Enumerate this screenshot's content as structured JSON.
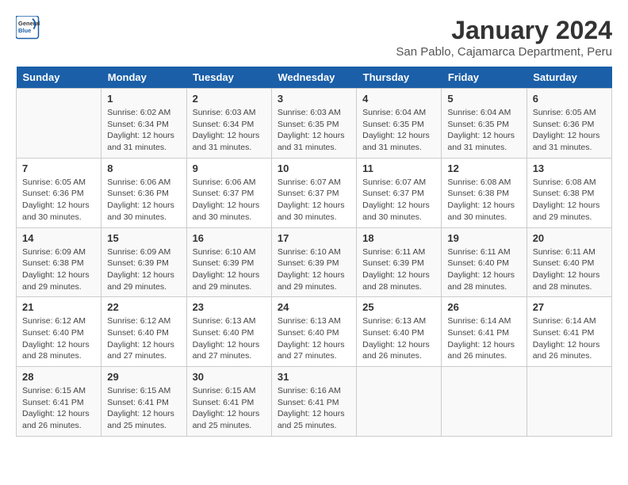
{
  "header": {
    "logo_line1": "General",
    "logo_line2": "Blue",
    "title": "January 2024",
    "subtitle": "San Pablo, Cajamarca Department, Peru"
  },
  "calendar": {
    "days_of_week": [
      "Sunday",
      "Monday",
      "Tuesday",
      "Wednesday",
      "Thursday",
      "Friday",
      "Saturday"
    ],
    "weeks": [
      [
        {
          "day": "",
          "info": ""
        },
        {
          "day": "1",
          "info": "Sunrise: 6:02 AM\nSunset: 6:34 PM\nDaylight: 12 hours\nand 31 minutes."
        },
        {
          "day": "2",
          "info": "Sunrise: 6:03 AM\nSunset: 6:34 PM\nDaylight: 12 hours\nand 31 minutes."
        },
        {
          "day": "3",
          "info": "Sunrise: 6:03 AM\nSunset: 6:35 PM\nDaylight: 12 hours\nand 31 minutes."
        },
        {
          "day": "4",
          "info": "Sunrise: 6:04 AM\nSunset: 6:35 PM\nDaylight: 12 hours\nand 31 minutes."
        },
        {
          "day": "5",
          "info": "Sunrise: 6:04 AM\nSunset: 6:35 PM\nDaylight: 12 hours\nand 31 minutes."
        },
        {
          "day": "6",
          "info": "Sunrise: 6:05 AM\nSunset: 6:36 PM\nDaylight: 12 hours\nand 31 minutes."
        }
      ],
      [
        {
          "day": "7",
          "info": "Sunrise: 6:05 AM\nSunset: 6:36 PM\nDaylight: 12 hours\nand 30 minutes."
        },
        {
          "day": "8",
          "info": "Sunrise: 6:06 AM\nSunset: 6:36 PM\nDaylight: 12 hours\nand 30 minutes."
        },
        {
          "day": "9",
          "info": "Sunrise: 6:06 AM\nSunset: 6:37 PM\nDaylight: 12 hours\nand 30 minutes."
        },
        {
          "day": "10",
          "info": "Sunrise: 6:07 AM\nSunset: 6:37 PM\nDaylight: 12 hours\nand 30 minutes."
        },
        {
          "day": "11",
          "info": "Sunrise: 6:07 AM\nSunset: 6:37 PM\nDaylight: 12 hours\nand 30 minutes."
        },
        {
          "day": "12",
          "info": "Sunrise: 6:08 AM\nSunset: 6:38 PM\nDaylight: 12 hours\nand 30 minutes."
        },
        {
          "day": "13",
          "info": "Sunrise: 6:08 AM\nSunset: 6:38 PM\nDaylight: 12 hours\nand 29 minutes."
        }
      ],
      [
        {
          "day": "14",
          "info": "Sunrise: 6:09 AM\nSunset: 6:38 PM\nDaylight: 12 hours\nand 29 minutes."
        },
        {
          "day": "15",
          "info": "Sunrise: 6:09 AM\nSunset: 6:39 PM\nDaylight: 12 hours\nand 29 minutes."
        },
        {
          "day": "16",
          "info": "Sunrise: 6:10 AM\nSunset: 6:39 PM\nDaylight: 12 hours\nand 29 minutes."
        },
        {
          "day": "17",
          "info": "Sunrise: 6:10 AM\nSunset: 6:39 PM\nDaylight: 12 hours\nand 29 minutes."
        },
        {
          "day": "18",
          "info": "Sunrise: 6:11 AM\nSunset: 6:39 PM\nDaylight: 12 hours\nand 28 minutes."
        },
        {
          "day": "19",
          "info": "Sunrise: 6:11 AM\nSunset: 6:40 PM\nDaylight: 12 hours\nand 28 minutes."
        },
        {
          "day": "20",
          "info": "Sunrise: 6:11 AM\nSunset: 6:40 PM\nDaylight: 12 hours\nand 28 minutes."
        }
      ],
      [
        {
          "day": "21",
          "info": "Sunrise: 6:12 AM\nSunset: 6:40 PM\nDaylight: 12 hours\nand 28 minutes."
        },
        {
          "day": "22",
          "info": "Sunrise: 6:12 AM\nSunset: 6:40 PM\nDaylight: 12 hours\nand 27 minutes."
        },
        {
          "day": "23",
          "info": "Sunrise: 6:13 AM\nSunset: 6:40 PM\nDaylight: 12 hours\nand 27 minutes."
        },
        {
          "day": "24",
          "info": "Sunrise: 6:13 AM\nSunset: 6:40 PM\nDaylight: 12 hours\nand 27 minutes."
        },
        {
          "day": "25",
          "info": "Sunrise: 6:13 AM\nSunset: 6:40 PM\nDaylight: 12 hours\nand 26 minutes."
        },
        {
          "day": "26",
          "info": "Sunrise: 6:14 AM\nSunset: 6:41 PM\nDaylight: 12 hours\nand 26 minutes."
        },
        {
          "day": "27",
          "info": "Sunrise: 6:14 AM\nSunset: 6:41 PM\nDaylight: 12 hours\nand 26 minutes."
        }
      ],
      [
        {
          "day": "28",
          "info": "Sunrise: 6:15 AM\nSunset: 6:41 PM\nDaylight: 12 hours\nand 26 minutes."
        },
        {
          "day": "29",
          "info": "Sunrise: 6:15 AM\nSunset: 6:41 PM\nDaylight: 12 hours\nand 25 minutes."
        },
        {
          "day": "30",
          "info": "Sunrise: 6:15 AM\nSunset: 6:41 PM\nDaylight: 12 hours\nand 25 minutes."
        },
        {
          "day": "31",
          "info": "Sunrise: 6:16 AM\nSunset: 6:41 PM\nDaylight: 12 hours\nand 25 minutes."
        },
        {
          "day": "",
          "info": ""
        },
        {
          "day": "",
          "info": ""
        },
        {
          "day": "",
          "info": ""
        }
      ]
    ]
  }
}
